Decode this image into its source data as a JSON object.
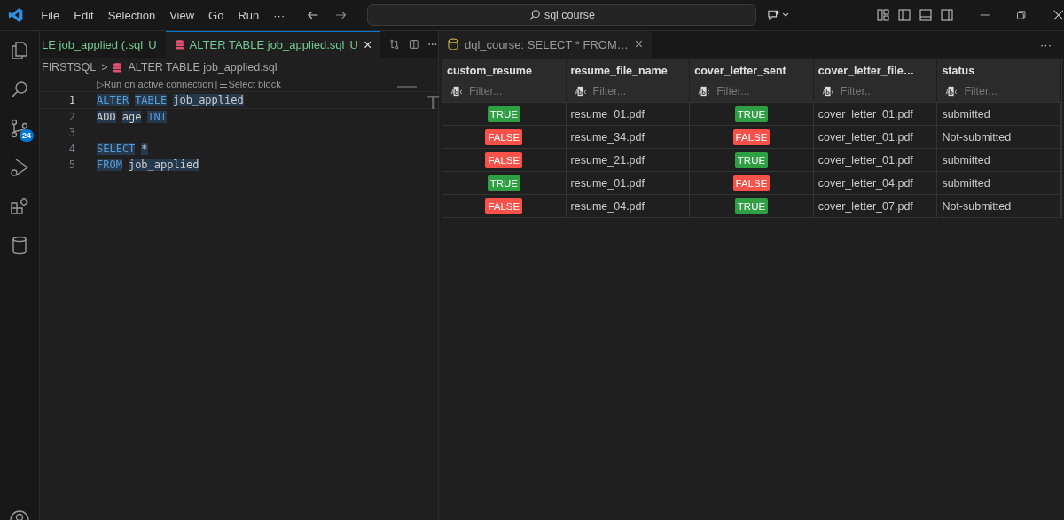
{
  "menu": [
    "File",
    "Edit",
    "Selection",
    "View",
    "Go",
    "Run",
    "···"
  ],
  "search": {
    "value": "sql course"
  },
  "activity": {
    "badge": "24"
  },
  "editor_tabs": [
    {
      "label": "LE job_applied (.sql",
      "status": "U",
      "selected": false
    },
    {
      "label": "ALTER TABLE job_applied.sql",
      "status": "U",
      "selected": true,
      "close": "×"
    }
  ],
  "breadcrumb": {
    "folder": "FIRSTSQL",
    "separator": ">",
    "file": "ALTER TABLE job_applied.sql"
  },
  "codelens": [
    {
      "icon": "▷",
      "label": "Run on active connection"
    },
    {
      "icon": "☰",
      "label": "Select block"
    }
  ],
  "codelens_separator": "|",
  "lines": [
    {
      "number": "1",
      "current": true,
      "tokens": [
        {
          "text": "ALTER",
          "kind": "keyword"
        },
        {
          "text": "TABLE",
          "kind": "keyword"
        },
        {
          "text": "job_applied",
          "kind": "plain"
        }
      ]
    },
    {
      "number": "2",
      "current": false,
      "tokens": [
        {
          "text": "ADD",
          "kind": "plain"
        },
        {
          "text": "age",
          "kind": "plain"
        },
        {
          "text": "INT",
          "kind": "keyword"
        }
      ]
    },
    {
      "number": "3",
      "current": false
    },
    {
      "number": "4",
      "current": false,
      "tokens": [
        {
          "text": "SELECT",
          "kind": "keyword"
        },
        {
          "text": "*",
          "kind": "plain"
        }
      ]
    },
    {
      "number": "5",
      "current": false,
      "tokens": [
        {
          "text": "FROM",
          "kind": "keyword"
        },
        {
          "text": "job_applied",
          "kind": "plain"
        }
      ]
    }
  ],
  "overflow_glyph": "T",
  "results_tab": {
    "label": "dql_course: SELECT * FROM…",
    "close": "×",
    "more": "···"
  },
  "table": {
    "columns": [
      {
        "name": "custom_resume",
        "placeholder": "Filter..."
      },
      {
        "name": "resume_file_name",
        "placeholder": "Filter..."
      },
      {
        "name": "cover_letter_sent",
        "placeholder": "Filter..."
      },
      {
        "name": "cover_letter_file…",
        "placeholder": "Filter..."
      },
      {
        "name": "status",
        "placeholder": "Filter..."
      }
    ],
    "rows": [
      [
        {
          "kind": "bool",
          "text": "TRUE",
          "on": true
        },
        {
          "kind": "text",
          "text": "resume_01.pdf"
        },
        {
          "kind": "bool",
          "text": "TRUE",
          "on": true
        },
        {
          "kind": "text",
          "text": "cover_letter_01.pdf"
        },
        {
          "kind": "text",
          "text": "submitted"
        }
      ],
      [
        {
          "kind": "bool",
          "text": "FALSE",
          "on": false
        },
        {
          "kind": "text",
          "text": "resume_34.pdf"
        },
        {
          "kind": "bool",
          "text": "FALSE",
          "on": false
        },
        {
          "kind": "text",
          "text": "cover_letter_01.pdf"
        },
        {
          "kind": "text",
          "text": "Not-submitted"
        }
      ],
      [
        {
          "kind": "bool",
          "text": "FALSE",
          "on": false
        },
        {
          "kind": "text",
          "text": "resume_21.pdf"
        },
        {
          "kind": "bool",
          "text": "TRUE",
          "on": true
        },
        {
          "kind": "text",
          "text": "cover_letter_01.pdf"
        },
        {
          "kind": "text",
          "text": "submitted"
        }
      ],
      [
        {
          "kind": "bool",
          "text": "TRUE",
          "on": true
        },
        {
          "kind": "text",
          "text": "resume_01.pdf"
        },
        {
          "kind": "bool",
          "text": "FALSE",
          "on": false
        },
        {
          "kind": "text",
          "text": "cover_letter_04.pdf"
        },
        {
          "kind": "text",
          "text": "submitted"
        }
      ],
      [
        {
          "kind": "bool",
          "text": "FALSE",
          "on": false
        },
        {
          "kind": "text",
          "text": "resume_04.pdf"
        },
        {
          "kind": "bool",
          "text": "TRUE",
          "on": true
        },
        {
          "kind": "text",
          "text": "cover_letter_07.pdf"
        },
        {
          "kind": "text",
          "text": "Not-submitted"
        }
      ]
    ]
  }
}
